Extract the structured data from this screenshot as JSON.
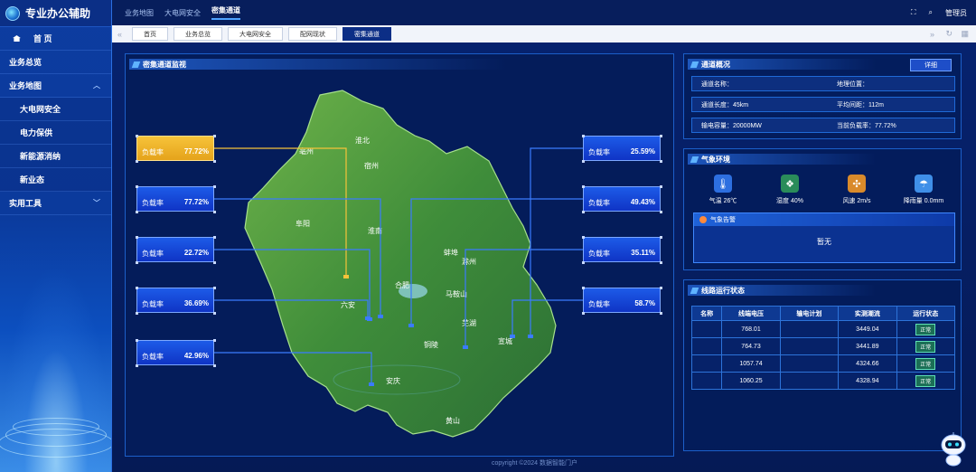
{
  "app": {
    "title": "专业办公辅助"
  },
  "sidebar": {
    "items": [
      {
        "label": "首 页",
        "type": "home"
      },
      {
        "label": "业务总览",
        "type": "top"
      },
      {
        "label": "业务地图",
        "type": "top",
        "expanded": true
      },
      {
        "label": "大电网安全",
        "type": "sub"
      },
      {
        "label": "电力保供",
        "type": "sub"
      },
      {
        "label": "新能源消纳",
        "type": "sub"
      },
      {
        "label": "新业态",
        "type": "sub"
      },
      {
        "label": "实用工具",
        "type": "top",
        "expanded": false
      }
    ]
  },
  "topbar": {
    "tabs": [
      {
        "label": "业务地图"
      },
      {
        "label": "大电网安全"
      },
      {
        "label": "密集通道",
        "active": true
      }
    ],
    "user": "管理员"
  },
  "pagetabs": [
    {
      "label": "首页"
    },
    {
      "label": "业务总览"
    },
    {
      "label": "大电网安全"
    },
    {
      "label": "配网现状"
    },
    {
      "label": "密集通道",
      "active": true
    }
  ],
  "map": {
    "title": "密集通道监视",
    "load_label": "负载率",
    "cities": [
      "淮北",
      "亳州",
      "宿州",
      "阜阳",
      "淮南",
      "蚌埠",
      "合肥",
      "滁州",
      "六安",
      "马鞍山",
      "芜湖",
      "铜陵",
      "安庆",
      "宣城",
      "黄山"
    ],
    "left_boxes": [
      {
        "value": "77.72%",
        "color": "yellow"
      },
      {
        "value": "77.72%",
        "color": "blue"
      },
      {
        "value": "22.72%",
        "color": "blue"
      },
      {
        "value": "36.69%",
        "color": "blue"
      },
      {
        "value": "42.96%",
        "color": "blue"
      }
    ],
    "right_boxes": [
      {
        "value": "25.59%"
      },
      {
        "value": "49.43%"
      },
      {
        "value": "35.11%"
      },
      {
        "value": "58.7%"
      }
    ]
  },
  "overview": {
    "title": "通道概况",
    "detail_button": "详细",
    "rows": [
      {
        "left": "通道名称：  ",
        "right": "地理位置：  "
      },
      {
        "left": "通道长度：45km",
        "right": "平均间距：112m"
      },
      {
        "left": "输电容量：20000MW",
        "right": "当前负载率：77.72%"
      }
    ]
  },
  "weather": {
    "title": "气象环境",
    "items": [
      {
        "label": "气温",
        "value": "26℃",
        "icon": "thermometer-icon",
        "color": "#2d6fe0"
      },
      {
        "label": "湿度",
        "value": "40%",
        "icon": "humidity-icon",
        "color": "#2a8c5a"
      },
      {
        "label": "风速",
        "value": "2m/s",
        "icon": "fan-icon",
        "color": "#d98a2b"
      },
      {
        "label": "降雨量",
        "value": "0.0mm",
        "icon": "rain-icon",
        "color": "#3f8fe8"
      }
    ],
    "alarm_title": "气象告警",
    "alarm_text": "暂无"
  },
  "lines": {
    "title": "线路运行状态",
    "columns": [
      "名称",
      "线端电压",
      "输电计划",
      "实测潮流",
      "运行状态"
    ],
    "rows": [
      {
        "name": "",
        "voltage": "768.01",
        "plan": "",
        "flow": "3449.04",
        "status": "正常"
      },
      {
        "name": "",
        "voltage": "764.73",
        "plan": "",
        "flow": "3441.89",
        "status": "正常"
      },
      {
        "name": "",
        "voltage": "1057.74",
        "plan": "",
        "flow": "4324.66",
        "status": "正常"
      },
      {
        "name": "",
        "voltage": "1060.25",
        "plan": "",
        "flow": "4328.94",
        "status": "正常"
      }
    ]
  },
  "footer": {
    "copyright": "copyright ©2024 数据智能门户"
  },
  "colors": {
    "accent": "#4fa3ff",
    "panel": "#041c5a",
    "ok": "#1b6f56",
    "warn": "#f6c33a"
  }
}
